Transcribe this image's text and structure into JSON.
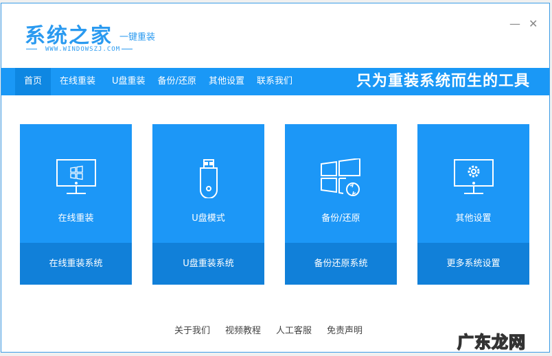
{
  "app": {
    "logo": "系统之家",
    "subtitle": "一键重装",
    "url": "WWW.WINDOWSZJ.COM"
  },
  "window": {
    "minimize": "—",
    "close": "✕"
  },
  "nav": {
    "items": [
      "首页",
      "在线重装",
      "U盘重装",
      "备份/还原",
      "其他设置",
      "联系我们"
    ],
    "slogan": "只为重装系统而生的工具"
  },
  "cards": [
    {
      "icon": "monitor-windows-icon",
      "title": "在线重装",
      "action": "在线重装系统"
    },
    {
      "icon": "usb-drive-icon",
      "title": "U盘模式",
      "action": "U盘重装系统"
    },
    {
      "icon": "windows-restore-icon",
      "title": "备份/还原",
      "action": "备份还原系统"
    },
    {
      "icon": "monitor-gear-icon",
      "title": "其他设置",
      "action": "更多系统设置"
    }
  ],
  "footer": [
    "关于我们",
    "视频教程",
    "人工客服",
    "免责声明"
  ],
  "watermark": "广东龙网",
  "colors": {
    "accent": "#1a98f6",
    "card_bottom": "#1180d9"
  }
}
